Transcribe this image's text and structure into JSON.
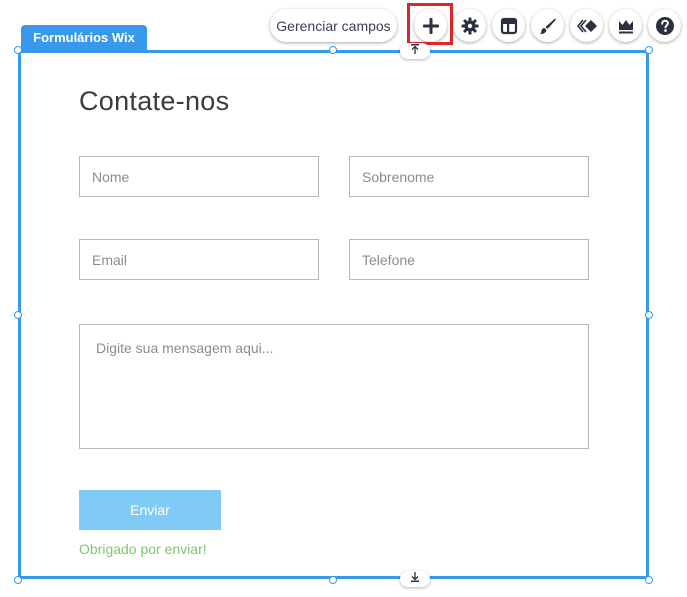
{
  "toolbar": {
    "manage_fields_label": "Gerenciar campos",
    "buttons": [
      {
        "icon": "plus-icon"
      },
      {
        "icon": "gear-icon"
      },
      {
        "icon": "layout-icon"
      },
      {
        "icon": "paintbrush-icon"
      },
      {
        "icon": "animation-icon"
      },
      {
        "icon": "crown-icon"
      },
      {
        "icon": "help-icon"
      }
    ],
    "highlight_color": "#e0262a"
  },
  "component": {
    "tag_label": "Formulários Wix",
    "accent_color": "#3899ec"
  },
  "form": {
    "title": "Contate-nos",
    "fields": {
      "first_name_placeholder": "Nome",
      "last_name_placeholder": "Sobrenome",
      "email_placeholder": "Email",
      "phone_placeholder": "Telefone",
      "message_placeholder": "Digite sua mensagem aqui..."
    },
    "submit_label": "Enviar",
    "submit_color": "#7fcbf5",
    "success_message": "Obrigado por enviar!",
    "success_color": "#7fc56f"
  }
}
